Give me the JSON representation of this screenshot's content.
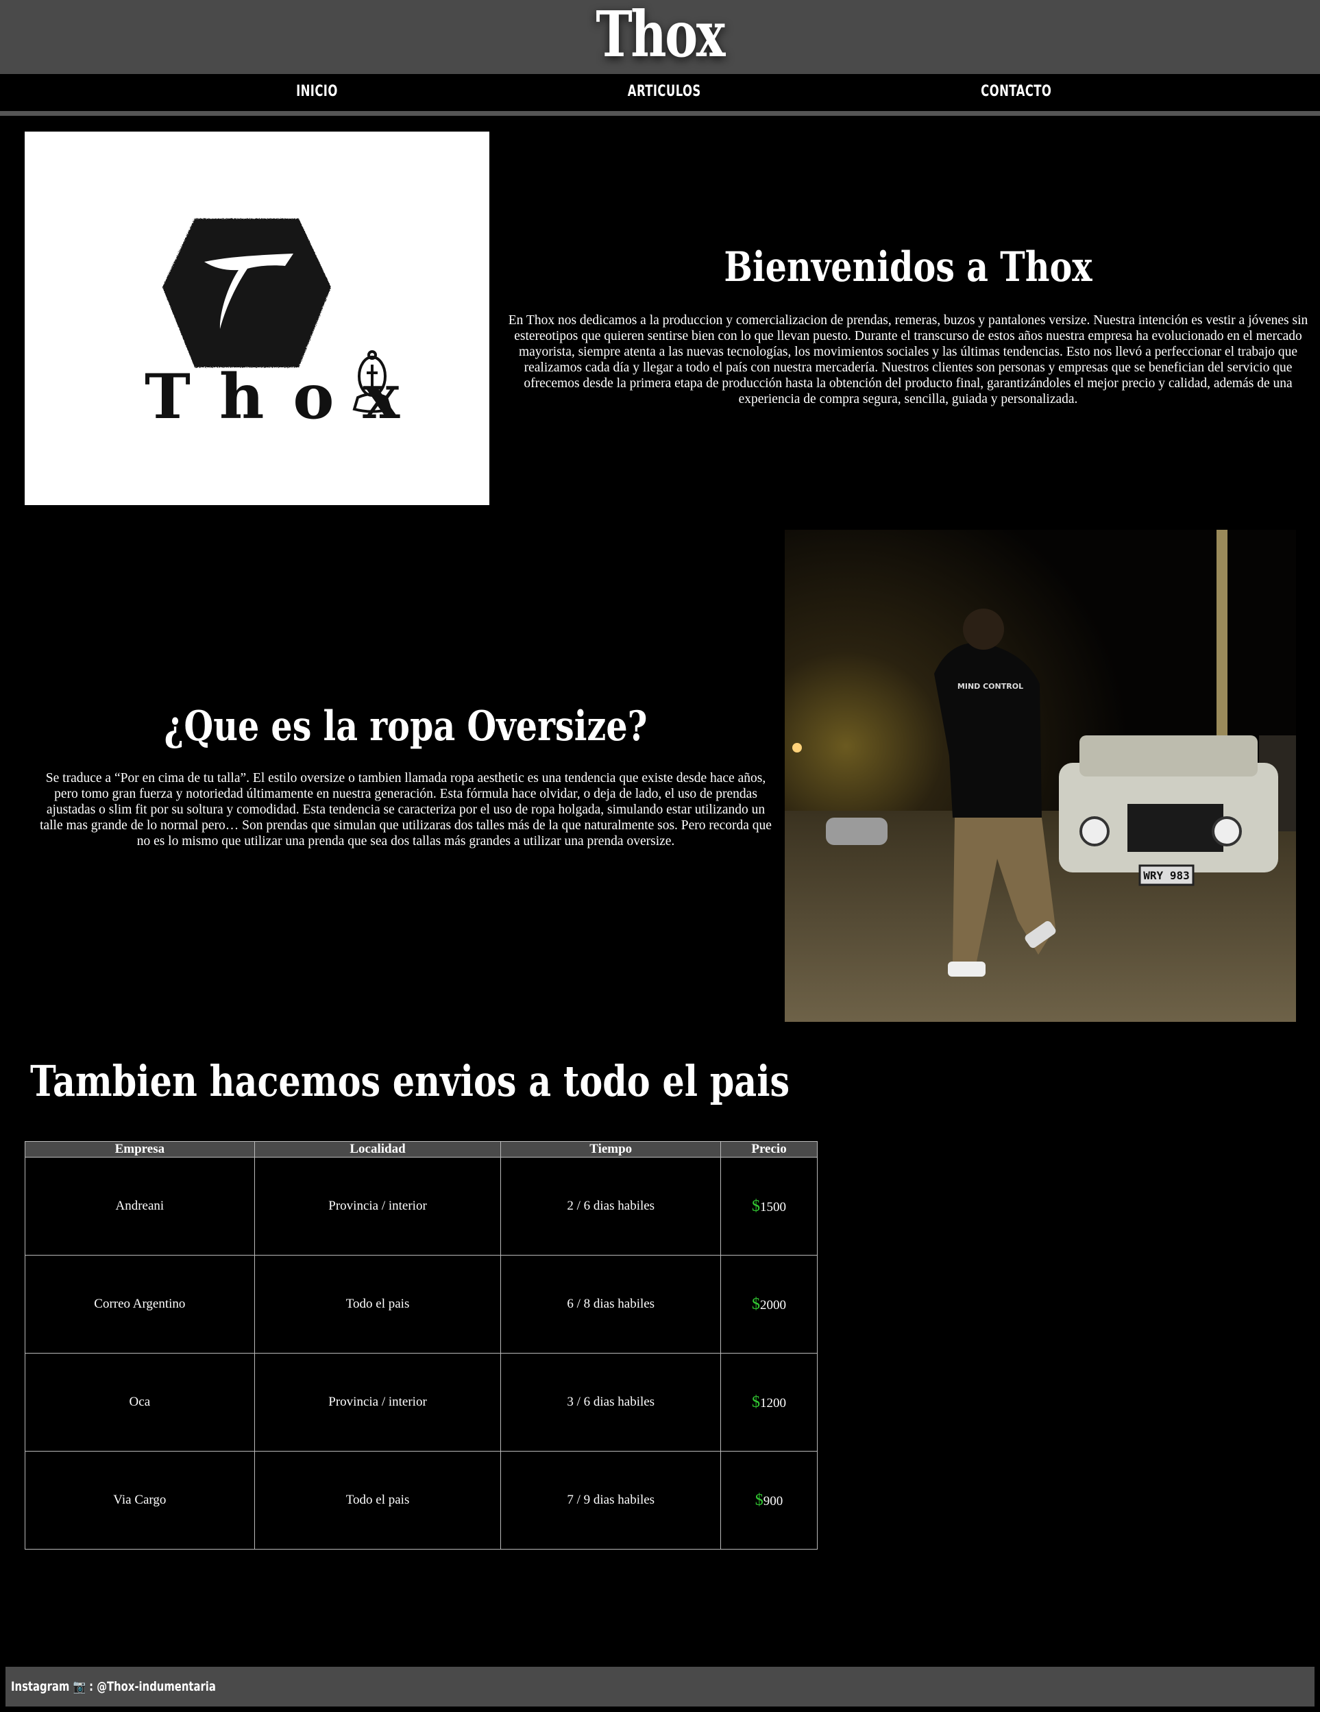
{
  "header": {
    "title": "Thox"
  },
  "nav": {
    "items": [
      {
        "label": "INICIO"
      },
      {
        "label": "ARTICULOS"
      },
      {
        "label": "CONTACTO"
      }
    ]
  },
  "logo": {
    "wordmark": "Thox",
    "monogram": "T"
  },
  "welcome": {
    "title": "Bienvenidos a Thox",
    "body": "En Thox nos dedicamos a la produccion y comercializacion de prendas, remeras, buzos y pantalones versize. Nuestra intención es vestir a jóvenes sin estereotipos que quieren sentirse bien con lo que llevan puesto. Durante el transcurso de estos años nuestra empresa ha evolucionado en el mercado mayorista, siempre atenta a las nuevas tecnologías, los movimientos sociales y las últimas tendencias. Esto nos llevó a perfeccionar el trabajo que realizamos cada día y llegar a todo el país con nuestra mercadería. Nuestros clientes son personas y empresas que se benefician del servicio que ofrecemos desde la primera etapa de producción hasta la obtención del producto final, garantizándoles el mejor precio y calidad, además de una experiencia de compra segura, sencilla, guiada y personalizada."
  },
  "oversize": {
    "title": "¿Que es la ropa Oversize?",
    "body": "Se traduce a “Por en cima de tu talla”. El estilo oversize o tambien llamada ropa aesthetic es una tendencia que existe desde hace años, pero tomo gran fuerza y notoriedad últimamente en nuestra generación. Esta fórmula hace olvidar, o deja de lado, el uso de prendas ajustadas o slim fit por su soltura y comodidad. Esta tendencia se caracteriza por el uso de ropa holgada, simulando estar utilizando un talle mas grande de lo normal pero… Son prendas que simulan que utilizaras dos talles más de la que naturalmente sos. Pero recorda que no es lo mismo que utilizar una prenda que sea dos tallas más grandes a utilizar una prenda oversize."
  },
  "photo": {
    "shirt_text": "MIND CONTROL",
    "plate": "WRY 983"
  },
  "envios": {
    "title": "Tambien hacemos envios a todo el pais",
    "headers": [
      "Empresa",
      "Localidad",
      "Tiempo",
      "Precio"
    ],
    "currency_symbol": "$",
    "rows": [
      {
        "empresa": "Andreani",
        "localidad": "Provincia / interior",
        "tiempo": "2 / 6 dias habiles",
        "precio": "1500"
      },
      {
        "empresa": "Correo Argentino",
        "localidad": "Todo el pais",
        "tiempo": "6 / 8 dias habiles",
        "precio": "2000"
      },
      {
        "empresa": "Oca",
        "localidad": "Provincia / interior",
        "tiempo": "3 / 6 dias habiles",
        "precio": "1200"
      },
      {
        "empresa": "Via Cargo",
        "localidad": "Todo el pais",
        "tiempo": "7 / 9 dias habiles",
        "precio": "900"
      }
    ]
  },
  "footer": {
    "text": "Instagram 📷 : @Thox-indumentaria"
  },
  "colors": {
    "header_bg": "#4a4a4a",
    "page_bg": "#000000",
    "price_symbol": "#32c832"
  }
}
